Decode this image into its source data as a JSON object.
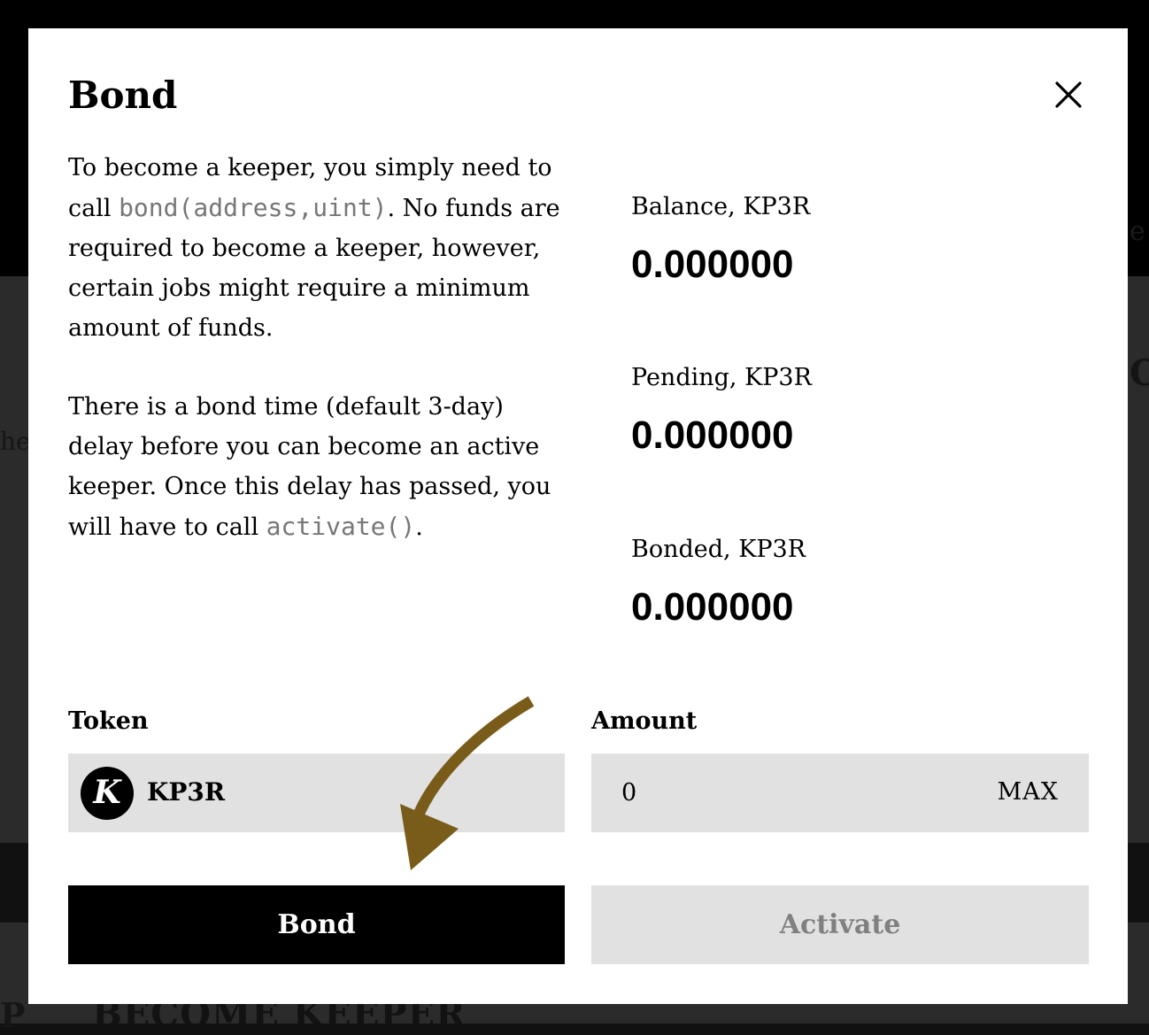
{
  "background": {
    "heading_fragment": "BECOME KEEPER",
    "left_fragment": "he",
    "right_fragment": "O",
    "right_top_fragment": "e",
    "bottom_left_fragment": "P"
  },
  "modal": {
    "title": "Bond",
    "description": {
      "p1_before": "To become a keeper, you simply need to call ",
      "p1_code": "bond(address,uint)",
      "p1_after": ". No funds are required to become a keeper, however, certain jobs might require a minimum amount of funds.",
      "p2_before": "There is a bond time (default 3-day) delay before you can become an active keeper. Once this delay has passed, you will have to call ",
      "p2_code": "activate()",
      "p2_after": "."
    },
    "stats": {
      "balance": {
        "label": "Balance, KP3R",
        "value": "0.000000"
      },
      "pending": {
        "label": "Pending, KP3R",
        "value": "0.000000"
      },
      "bonded": {
        "label": "Bonded, KP3R",
        "value": "0.000000"
      }
    },
    "token": {
      "label": "Token",
      "selected": "KP3R",
      "icon_glyph": "K"
    },
    "amount": {
      "label": "Amount",
      "value": "0",
      "max_label": "MAX"
    },
    "buttons": {
      "bond": "Bond",
      "activate": "Activate"
    }
  },
  "icons": {
    "close": "close-icon",
    "token": "kp3r-logo-icon",
    "annotation": "curved-arrow-icon"
  },
  "colors": {
    "modal_bg": "#ffffff",
    "field_bg": "#e1e1e1",
    "primary_button": "#000000",
    "disabled_text": "#808080",
    "code_text": "#777777",
    "annotation_arrow": "#7a5c1a"
  }
}
